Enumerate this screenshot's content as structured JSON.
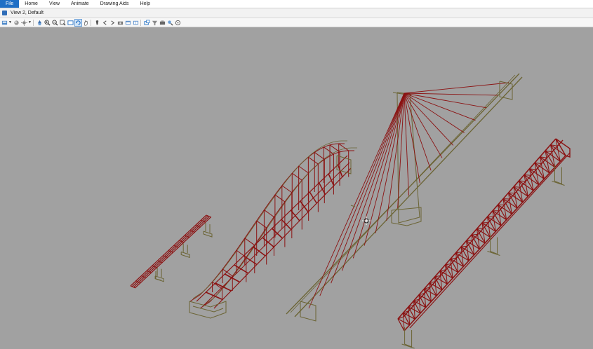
{
  "menu": {
    "items": [
      "File",
      "Home",
      "View",
      "Animate",
      "Drawing Aids",
      "Help"
    ]
  },
  "view": {
    "title": "View 2, Default"
  },
  "toolbar": {
    "buttons": [
      "view-attributes-icon",
      "caret-down-icon",
      "display-style-icon",
      "brightness-icon",
      "caret-down-icon",
      "update-view-icon",
      "zoom-in-icon",
      "zoom-out-icon",
      "zoom-window-icon",
      "fit-view-icon",
      "rotate-view-icon",
      "pan-view-icon",
      "walk-icon",
      "previous-view-icon",
      "next-view-icon",
      "camera-icon",
      "view-window-icon",
      "copy-view-icon",
      "save-view-icon",
      "clip-volume-icon",
      "render-icon",
      "find-icon",
      "more-icon"
    ]
  },
  "colors": {
    "steel_red": "#8b1212",
    "concrete_olive": "#6b6434",
    "background": "#a1a1a1",
    "accent_blue": "#1f6fc5"
  }
}
